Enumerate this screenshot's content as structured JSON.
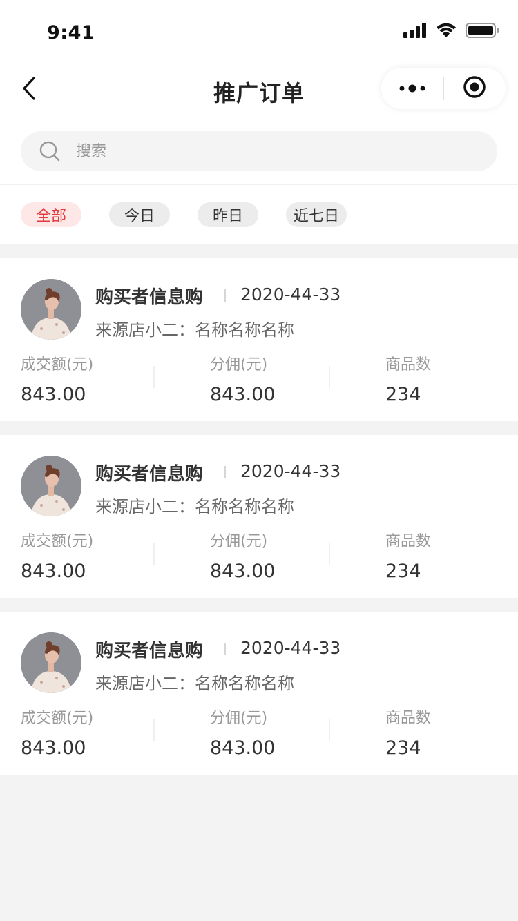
{
  "status_bar": {
    "time": "9:41"
  },
  "nav": {
    "title": "推广订单"
  },
  "search": {
    "placeholder": "搜索"
  },
  "filters": [
    {
      "label": "全部",
      "active": true
    },
    {
      "label": "今日",
      "active": false
    },
    {
      "label": "昨日",
      "active": false
    },
    {
      "label": "近七日",
      "active": false
    }
  ],
  "orders": [
    {
      "buyer": "购买者信息购",
      "date": "2020-44-33",
      "source": "来源店小二：名称名称名称",
      "stats": [
        {
          "label": "成交额(元)",
          "value": "843.00"
        },
        {
          "label": "分佣(元)",
          "value": "843.00"
        },
        {
          "label": "商品数",
          "value": "234"
        }
      ]
    },
    {
      "buyer": "购买者信息购",
      "date": "2020-44-33",
      "source": "来源店小二：名称名称名称",
      "stats": [
        {
          "label": "成交额(元)",
          "value": "843.00"
        },
        {
          "label": "分佣(元)",
          "value": "843.00"
        },
        {
          "label": "商品数",
          "value": "234"
        }
      ]
    },
    {
      "buyer": "购买者信息购",
      "date": "2020-44-33",
      "source": "来源店小二：名称名称名称",
      "stats": [
        {
          "label": "成交额(元)",
          "value": "843.00"
        },
        {
          "label": "分佣(元)",
          "value": "843.00"
        },
        {
          "label": "商品数",
          "value": "234"
        }
      ]
    }
  ],
  "colors": {
    "accent": "#e0383b",
    "accent_bg": "#fde7e7",
    "page_bg": "#f3f3f3"
  },
  "icons": {
    "back": "chevron-left-icon",
    "more": "more-dots-icon",
    "close": "target-circle-icon",
    "search": "search-icon"
  }
}
